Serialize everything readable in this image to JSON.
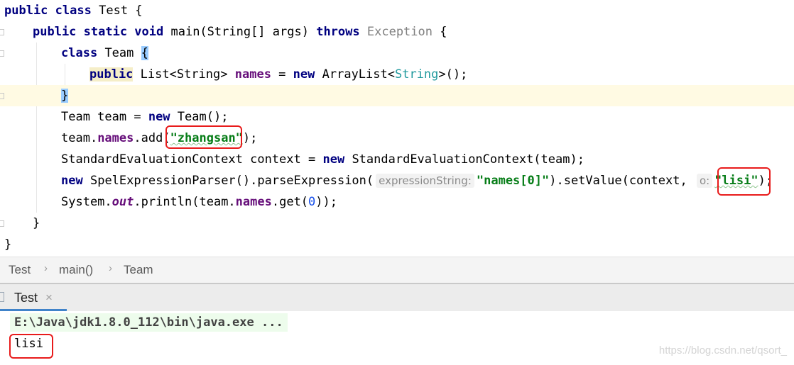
{
  "code": {
    "l1": {
      "kw_public": "public",
      "kw_class": "class",
      "class_name": "Test",
      "open": " {"
    },
    "l2": {
      "kw": "public static void",
      "rest": "main(String[] args)",
      "kw_throws": "throws",
      "exception": "Exception",
      "open": " {"
    },
    "l3": {
      "kw": "class",
      "name": "Team",
      "open": "{"
    },
    "l4": {
      "kw_public": "public",
      "type_pre": "List<String>",
      "field": "names",
      "eq": " = ",
      "kw_new": "new",
      "ctor": "ArrayList<",
      "generic": "String",
      "ctor_end": ">();"
    },
    "l5": {
      "close": "}"
    },
    "l6": {
      "pre": "Team team = ",
      "kw_new": "new",
      "post": "Team();"
    },
    "l7": {
      "pre": "team.",
      "field": "names",
      "mid": ".add(",
      "str": "\"zhangsan\"",
      "end": ");"
    },
    "l8": {
      "pre": "StandardEvaluationContext context = ",
      "kw_new": "new",
      "post": "StandardEvaluationContext(team);"
    },
    "l9": {
      "kw_new": "new",
      "pre": "SpelExpressionParser().parseExpression(",
      "hint1": "expressionString:",
      "str1": "\"names[0]\"",
      "mid": ").setValue(context, ",
      "hint2": "o:",
      "str2": "\"lisi\"",
      "end": ");"
    },
    "l10": {
      "pre": "System.",
      "sfield": "out",
      "mid": ".println(team.",
      "field": "names",
      "get": ".get(",
      "num": "0",
      "end": "));"
    },
    "l11": {
      "close": "}"
    },
    "l12": {
      "close": "}"
    }
  },
  "breadcrumb": {
    "items": [
      "Test",
      "main()",
      "Team"
    ],
    "separator": "›"
  },
  "run_tab": {
    "label": "Test",
    "close": "×"
  },
  "console": {
    "command": "E:\\Java\\jdk1.8.0_112\\bin\\java.exe ...",
    "output": "lisi"
  },
  "watermark": "https://blog.csdn.net/qsort_",
  "colors": {
    "keyword": "#000080",
    "field": "#660e7a",
    "string": "#067d17",
    "number": "#1750eb",
    "highlight_box": "#e81b1b",
    "tab_underline": "#4083c9"
  }
}
